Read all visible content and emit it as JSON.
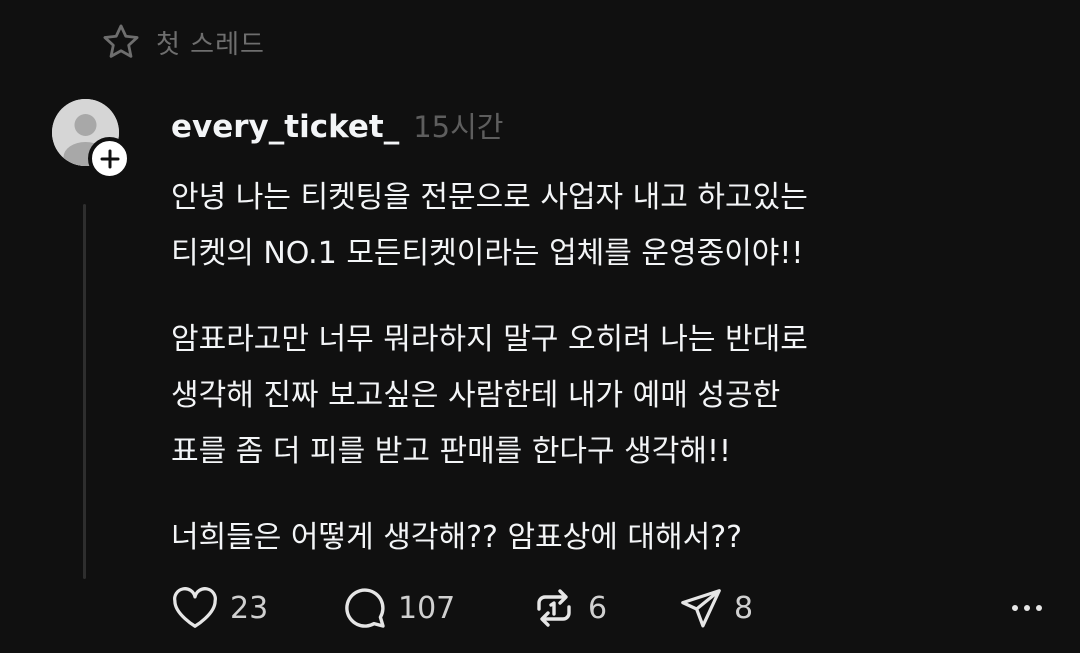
{
  "thread": {
    "header_label": "첫 스레드"
  },
  "post": {
    "username": "every_ticket_",
    "timestamp": "15시간",
    "paragraphs": [
      [
        "안녕 나는 티켓팅을 전문으로 사업자 내고 하고있는",
        "티켓의 NO.1 모든티켓이라는 업체를 운영중이야!!"
      ],
      [
        "암표라고만 너무 뭐라하지 말구 오히려 나는 반대로",
        "생각해 진짜 보고싶은 사람한테 내가 예매 성공한",
        "표를 좀 더 피를 받고 판매를 한다구 생각해!!"
      ],
      [
        "너희들은 어떻게 생각해?? 암표상에 대해서??"
      ]
    ]
  },
  "actions": {
    "likes": "23",
    "replies": "107",
    "reposts": "6",
    "shares": "8"
  },
  "icons": {
    "star": "star-icon",
    "avatar": "default-avatar-icon",
    "follow": "plus-icon",
    "like": "heart-icon",
    "reply": "comment-icon",
    "repost": "repost-icon",
    "share": "send-icon",
    "more": "more-icon"
  }
}
